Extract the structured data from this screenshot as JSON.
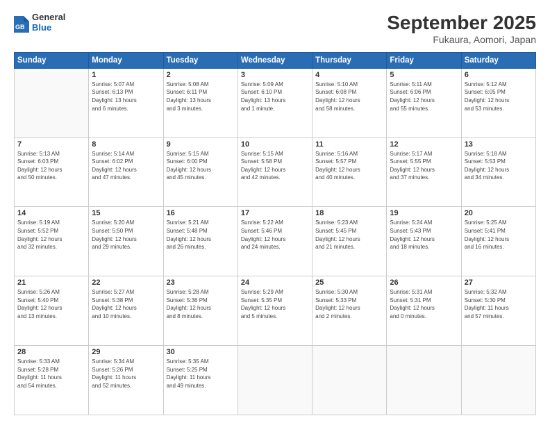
{
  "header": {
    "logo_general": "General",
    "logo_blue": "Blue",
    "title": "September 2025",
    "subtitle": "Fukaura, Aomori, Japan"
  },
  "columns": [
    "Sunday",
    "Monday",
    "Tuesday",
    "Wednesday",
    "Thursday",
    "Friday",
    "Saturday"
  ],
  "weeks": [
    [
      {
        "day": "",
        "info": ""
      },
      {
        "day": "1",
        "info": "Sunrise: 5:07 AM\nSunset: 6:13 PM\nDaylight: 13 hours\nand 6 minutes."
      },
      {
        "day": "2",
        "info": "Sunrise: 5:08 AM\nSunset: 6:11 PM\nDaylight: 13 hours\nand 3 minutes."
      },
      {
        "day": "3",
        "info": "Sunrise: 5:09 AM\nSunset: 6:10 PM\nDaylight: 13 hours\nand 1 minute."
      },
      {
        "day": "4",
        "info": "Sunrise: 5:10 AM\nSunset: 6:08 PM\nDaylight: 12 hours\nand 58 minutes."
      },
      {
        "day": "5",
        "info": "Sunrise: 5:11 AM\nSunset: 6:06 PM\nDaylight: 12 hours\nand 55 minutes."
      },
      {
        "day": "6",
        "info": "Sunrise: 5:12 AM\nSunset: 6:05 PM\nDaylight: 12 hours\nand 53 minutes."
      }
    ],
    [
      {
        "day": "7",
        "info": "Sunrise: 5:13 AM\nSunset: 6:03 PM\nDaylight: 12 hours\nand 50 minutes."
      },
      {
        "day": "8",
        "info": "Sunrise: 5:14 AM\nSunset: 6:02 PM\nDaylight: 12 hours\nand 47 minutes."
      },
      {
        "day": "9",
        "info": "Sunrise: 5:15 AM\nSunset: 6:00 PM\nDaylight: 12 hours\nand 45 minutes."
      },
      {
        "day": "10",
        "info": "Sunrise: 5:15 AM\nSunset: 5:58 PM\nDaylight: 12 hours\nand 42 minutes."
      },
      {
        "day": "11",
        "info": "Sunrise: 5:16 AM\nSunset: 5:57 PM\nDaylight: 12 hours\nand 40 minutes."
      },
      {
        "day": "12",
        "info": "Sunrise: 5:17 AM\nSunset: 5:55 PM\nDaylight: 12 hours\nand 37 minutes."
      },
      {
        "day": "13",
        "info": "Sunrise: 5:18 AM\nSunset: 5:53 PM\nDaylight: 12 hours\nand 34 minutes."
      }
    ],
    [
      {
        "day": "14",
        "info": "Sunrise: 5:19 AM\nSunset: 5:52 PM\nDaylight: 12 hours\nand 32 minutes."
      },
      {
        "day": "15",
        "info": "Sunrise: 5:20 AM\nSunset: 5:50 PM\nDaylight: 12 hours\nand 29 minutes."
      },
      {
        "day": "16",
        "info": "Sunrise: 5:21 AM\nSunset: 5:48 PM\nDaylight: 12 hours\nand 26 minutes."
      },
      {
        "day": "17",
        "info": "Sunrise: 5:22 AM\nSunset: 5:46 PM\nDaylight: 12 hours\nand 24 minutes."
      },
      {
        "day": "18",
        "info": "Sunrise: 5:23 AM\nSunset: 5:45 PM\nDaylight: 12 hours\nand 21 minutes."
      },
      {
        "day": "19",
        "info": "Sunrise: 5:24 AM\nSunset: 5:43 PM\nDaylight: 12 hours\nand 18 minutes."
      },
      {
        "day": "20",
        "info": "Sunrise: 5:25 AM\nSunset: 5:41 PM\nDaylight: 12 hours\nand 16 minutes."
      }
    ],
    [
      {
        "day": "21",
        "info": "Sunrise: 5:26 AM\nSunset: 5:40 PM\nDaylight: 12 hours\nand 13 minutes."
      },
      {
        "day": "22",
        "info": "Sunrise: 5:27 AM\nSunset: 5:38 PM\nDaylight: 12 hours\nand 10 minutes."
      },
      {
        "day": "23",
        "info": "Sunrise: 5:28 AM\nSunset: 5:36 PM\nDaylight: 12 hours\nand 8 minutes."
      },
      {
        "day": "24",
        "info": "Sunrise: 5:29 AM\nSunset: 5:35 PM\nDaylight: 12 hours\nand 5 minutes."
      },
      {
        "day": "25",
        "info": "Sunrise: 5:30 AM\nSunset: 5:33 PM\nDaylight: 12 hours\nand 2 minutes."
      },
      {
        "day": "26",
        "info": "Sunrise: 5:31 AM\nSunset: 5:31 PM\nDaylight: 12 hours\nand 0 minutes."
      },
      {
        "day": "27",
        "info": "Sunrise: 5:32 AM\nSunset: 5:30 PM\nDaylight: 11 hours\nand 57 minutes."
      }
    ],
    [
      {
        "day": "28",
        "info": "Sunrise: 5:33 AM\nSunset: 5:28 PM\nDaylight: 11 hours\nand 54 minutes."
      },
      {
        "day": "29",
        "info": "Sunrise: 5:34 AM\nSunset: 5:26 PM\nDaylight: 11 hours\nand 52 minutes."
      },
      {
        "day": "30",
        "info": "Sunrise: 5:35 AM\nSunset: 5:25 PM\nDaylight: 11 hours\nand 49 minutes."
      },
      {
        "day": "",
        "info": ""
      },
      {
        "day": "",
        "info": ""
      },
      {
        "day": "",
        "info": ""
      },
      {
        "day": "",
        "info": ""
      }
    ]
  ]
}
